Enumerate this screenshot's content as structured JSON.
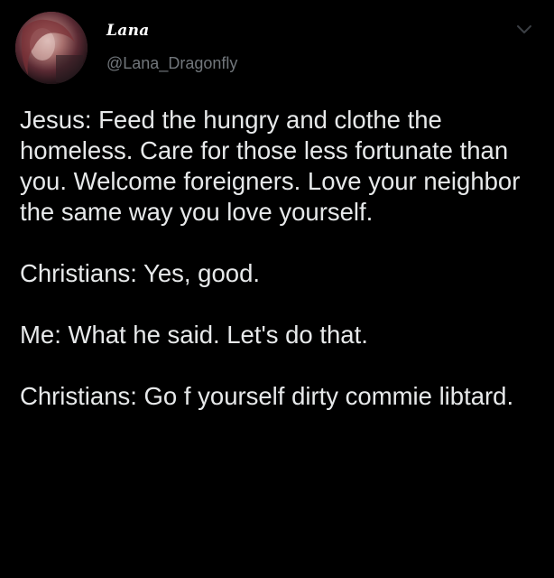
{
  "tweet": {
    "display_name": "Lana",
    "handle": "@Lana_Dragonfly",
    "paragraphs": [
      "Jesus: Feed the hungry and clothe the homeless. Care for those less fortunate than you. Welcome foreigners. Love your neighbor the same way you love yourself.",
      "Christians: Yes, good.",
      "Me: What he said. Let's do that.",
      "Christians: Go f yourself dirty commie libtard."
    ],
    "more_icon": "chevron-down-icon",
    "avatar_icon": "avatar"
  },
  "colors": {
    "background": "#000000",
    "text": "#e7e9ea",
    "secondary": "#71767b"
  }
}
